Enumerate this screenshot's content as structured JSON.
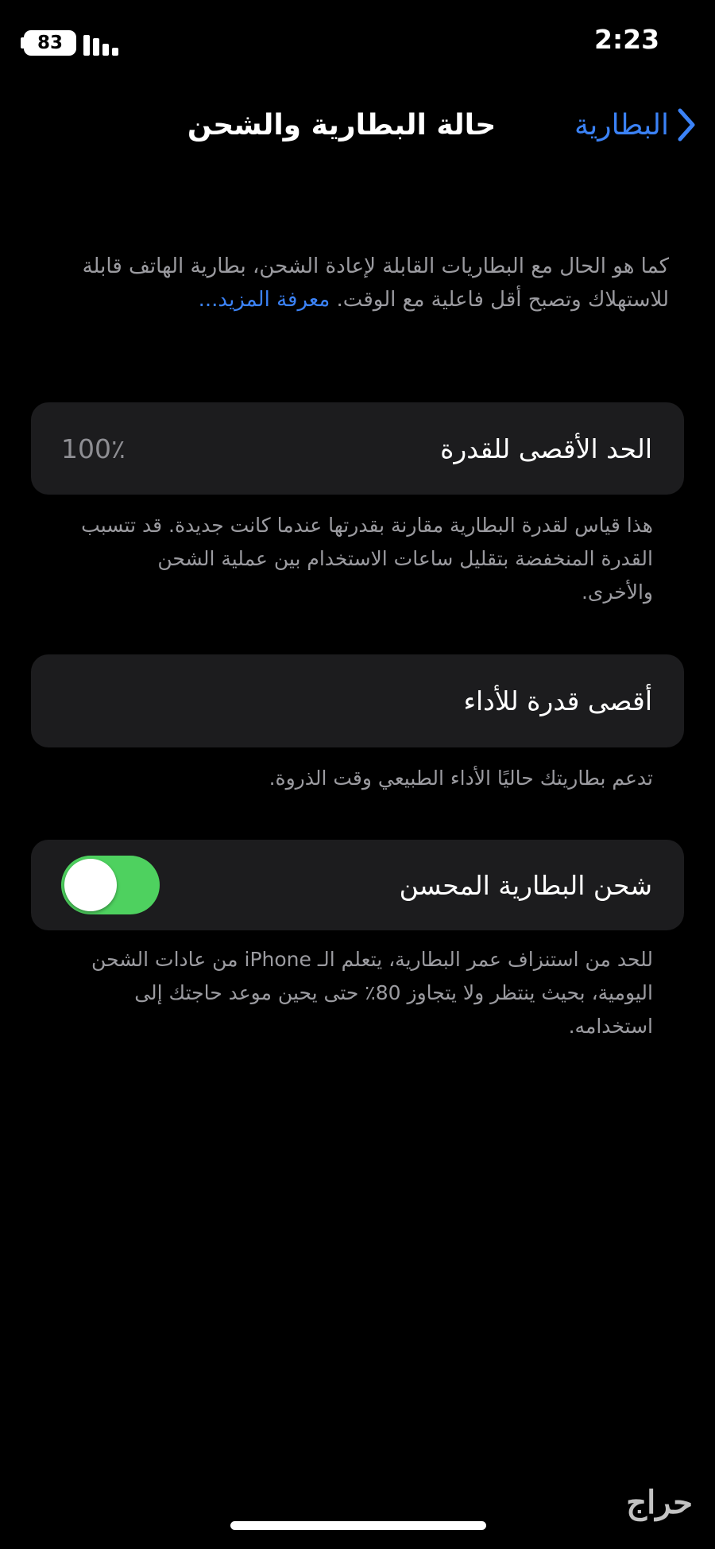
{
  "status_bar": {
    "time": "2:23",
    "battery_level": "83"
  },
  "nav": {
    "back_label": "البطارية",
    "title": "حالة البطارية والشحن"
  },
  "intro": {
    "text": "كما هو الحال مع البطاريات القابلة لإعادة الشحن، بطارية الهاتف قابلة للاستهلاك وتصبح أقل فاعلية مع الوقت.",
    "learn_more": "معرفة المزيد..."
  },
  "maximum_capacity": {
    "label": "الحد الأقصى للقدرة",
    "value": "100٪",
    "description": "هذا قياس لقدرة البطارية مقارنة بقدرتها عندما كانت جديدة. قد تتسبب القدرة المنخفضة بتقليل ساعات الاستخدام بين عملية الشحن والأخرى."
  },
  "peak_performance": {
    "label": "أقصى قدرة للأداء",
    "description": "تدعم بطاريتك حاليًا الأداء الطبيعي وقت الذروة."
  },
  "optimized_charging": {
    "label": "شحن البطارية المحسن",
    "enabled": true,
    "description": "للحد من استنزاف عمر البطارية، يتعلم الـ iPhone من عادات الشحن اليومية، بحيث ينتظر ولا يتجاوز 80٪ حتى يحين موعد حاجتك إلى استخدامه."
  },
  "watermark": "حراج",
  "colors": {
    "accent_blue": "#3b82f6",
    "toggle_on": "#4ed15f",
    "cell_background": "#1c1c1e",
    "secondary_text": "#9b9ba0"
  }
}
